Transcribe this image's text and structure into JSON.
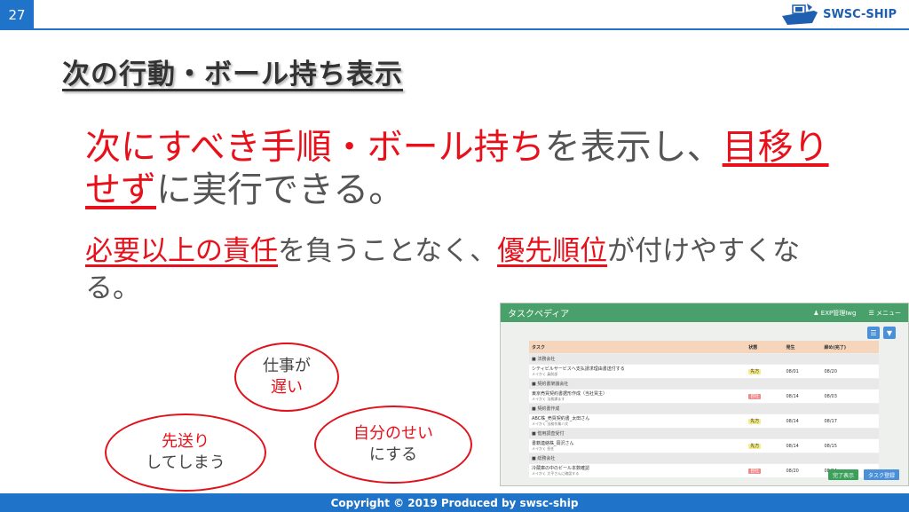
{
  "slide": {
    "page_number": "27",
    "logo_text": "SWSC-SHIP",
    "title": "次の行動・ボール持ち表示",
    "footer": "Copyright © 2019 Produced by swsc-ship"
  },
  "main_text": {
    "red1": "次にすべき手順・ボール持ち",
    "gray1": "を表示し、",
    "red2": "目移りせず",
    "gray2": "に実行できる。"
  },
  "sub_text": {
    "red1": "必要以上の責任",
    "gray1": "を負うことなく、",
    "red2": "優先順位",
    "gray2": "が付けやすくなる。"
  },
  "bubbles": {
    "b1_line1": "仕事が",
    "b1_line2": "遅い",
    "b2_line1": "先送り",
    "b2_line2": "してしまう",
    "b3_line1": "自分のせい",
    "b3_line2": "にする"
  },
  "screenshot": {
    "app_title": "タスクペディア",
    "user": "EXP管理Iwg",
    "menu": "メニュー",
    "headers": [
      "タスク",
      "状態",
      "発生",
      "締め(完了)"
    ],
    "rows": [
      {
        "group": true,
        "task": "■ 法務会社"
      },
      {
        "task": "シティビルサービスへ支払請求理由書送付する",
        "sub": "メイかく 員前部",
        "status": "先方",
        "status_kind": "y",
        "date1": "08/01",
        "date2": "08/20"
      },
      {
        "group": true,
        "task": "■ 契約書架議会社"
      },
      {
        "task": "東京売買契約書据形作成（当社買主）",
        "sub": "メイかく 法務課ます",
        "status": "自社",
        "status_kind": "p",
        "date1": "08/14",
        "date2": "08/03"
      },
      {
        "group": true,
        "task": "■ 契約書作成"
      },
      {
        "task": "ABC株_売買契約書_太田さん",
        "sub": "メイかく 法務作業ハ文",
        "status": "先方",
        "status_kind": "y",
        "date1": "08/14",
        "date2": "08/17"
      },
      {
        "group": true,
        "task": "■ 借用調査受付"
      },
      {
        "task": "書籍連絡株_岡沢さん",
        "sub": "メイかく 担任",
        "status": "先方",
        "status_kind": "y",
        "date1": "08/14",
        "date2": "08/15"
      },
      {
        "group": true,
        "task": "■ 総務会社"
      },
      {
        "task": "冷蔵庫の中のビール本数確認",
        "sub": "メイかく 大平さんに確認する",
        "status": "自社",
        "status_kind": "p",
        "date1": "08/20",
        "date2": "08/24"
      }
    ],
    "btn_complete": "完了表示",
    "btn_register": "タスク登録"
  }
}
